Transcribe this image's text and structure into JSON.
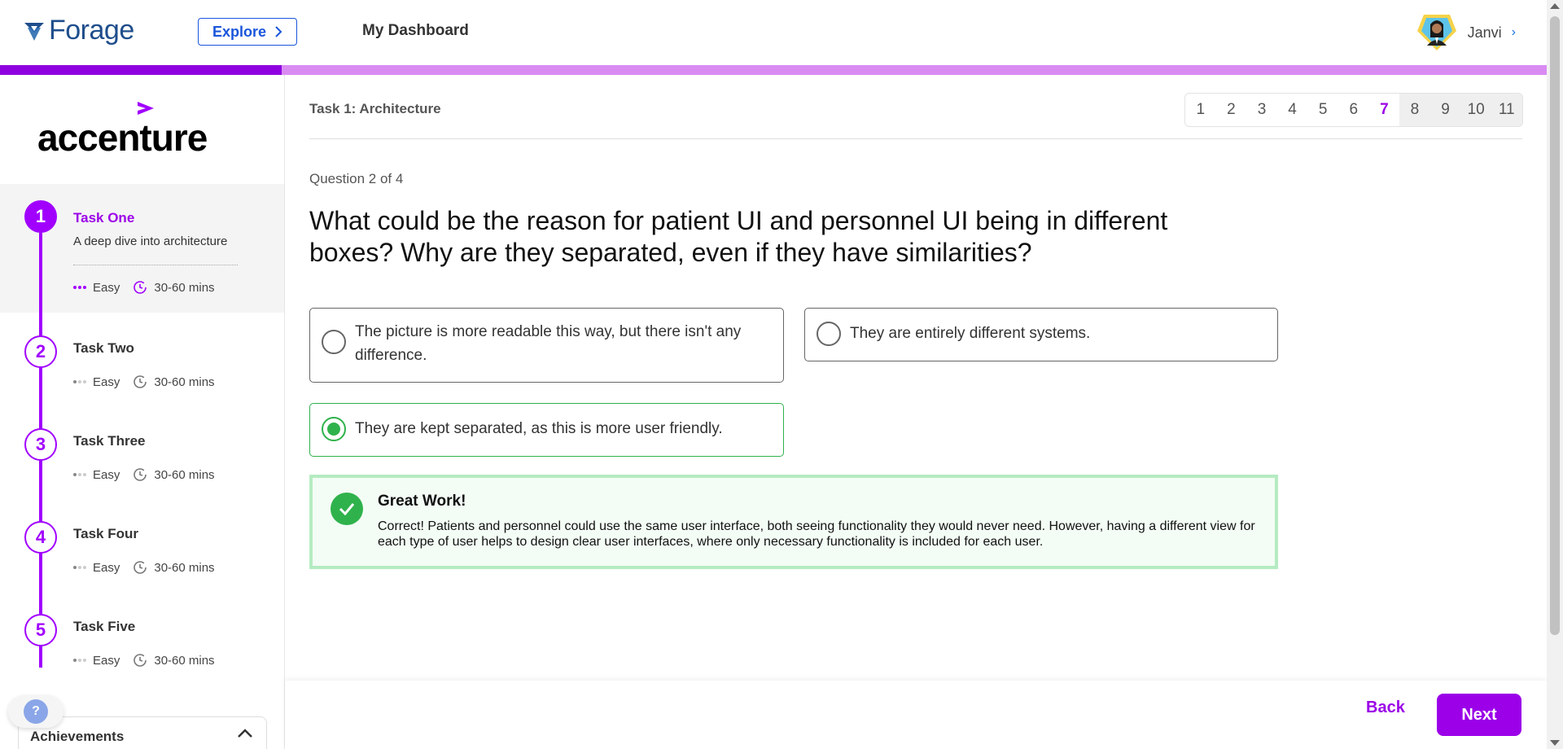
{
  "header": {
    "logo_text": "Forage",
    "explore_label": "Explore",
    "dashboard_label": "My Dashboard",
    "user_name": "Janvi"
  },
  "progress": {
    "fraction": 0.1823
  },
  "sidebar": {
    "brand": "accenture",
    "tasks": [
      {
        "number": "1",
        "title": "Task One",
        "desc": "A deep dive into architecture",
        "difficulty": "Easy",
        "time": "30-60 mins"
      },
      {
        "number": "2",
        "title": "Task Two",
        "desc": "",
        "difficulty": "Easy",
        "time": "30-60 mins"
      },
      {
        "number": "3",
        "title": "Task Three",
        "desc": "",
        "difficulty": "Easy",
        "time": "30-60 mins"
      },
      {
        "number": "4",
        "title": "Task Four",
        "desc": "",
        "difficulty": "Easy",
        "time": "30-60 mins"
      },
      {
        "number": "5",
        "title": "Task Five",
        "desc": "",
        "difficulty": "Easy",
        "time": "30-60 mins"
      }
    ],
    "help_label": "?",
    "achievements_label": "Achievements"
  },
  "main": {
    "task_heading": "Task 1: Architecture",
    "pages": [
      "1",
      "2",
      "3",
      "4",
      "5",
      "6",
      "7",
      "8",
      "9",
      "10",
      "11"
    ],
    "current_page": "7",
    "question_count": "Question 2 of 4",
    "question": "What could be the reason for patient UI and personnel UI being in different boxes? Why are they separated, even if they have similarities?",
    "options": [
      "The picture is more readable this way, but there isn't any difference.",
      "They are entirely different systems.",
      "They are kept separated, as this is more user friendly."
    ],
    "selected_option": 2,
    "feedback": {
      "title": "Great Work!",
      "text": "Correct! Patients and personnel could use the same user interface, both seeing functionality they would never need. However, having a different view for each type of user helps to design clear user interfaces, where only necessary functionality is included for each user."
    },
    "back_label": "Back",
    "next_label": "Next"
  },
  "colors": {
    "accent": "#9b00e8",
    "progress_track": "#d98bf2",
    "success": "#2fb24c",
    "success_bg": "#f3fcf5",
    "link_blue": "#1a56db"
  },
  "icons": {
    "logo": "forage-logo-icon",
    "explore": "chevron-right-icon",
    "avatar": "avatar-icon",
    "clock": "clock-icon",
    "check": "check-icon",
    "collapse": "chevron-up-icon"
  }
}
